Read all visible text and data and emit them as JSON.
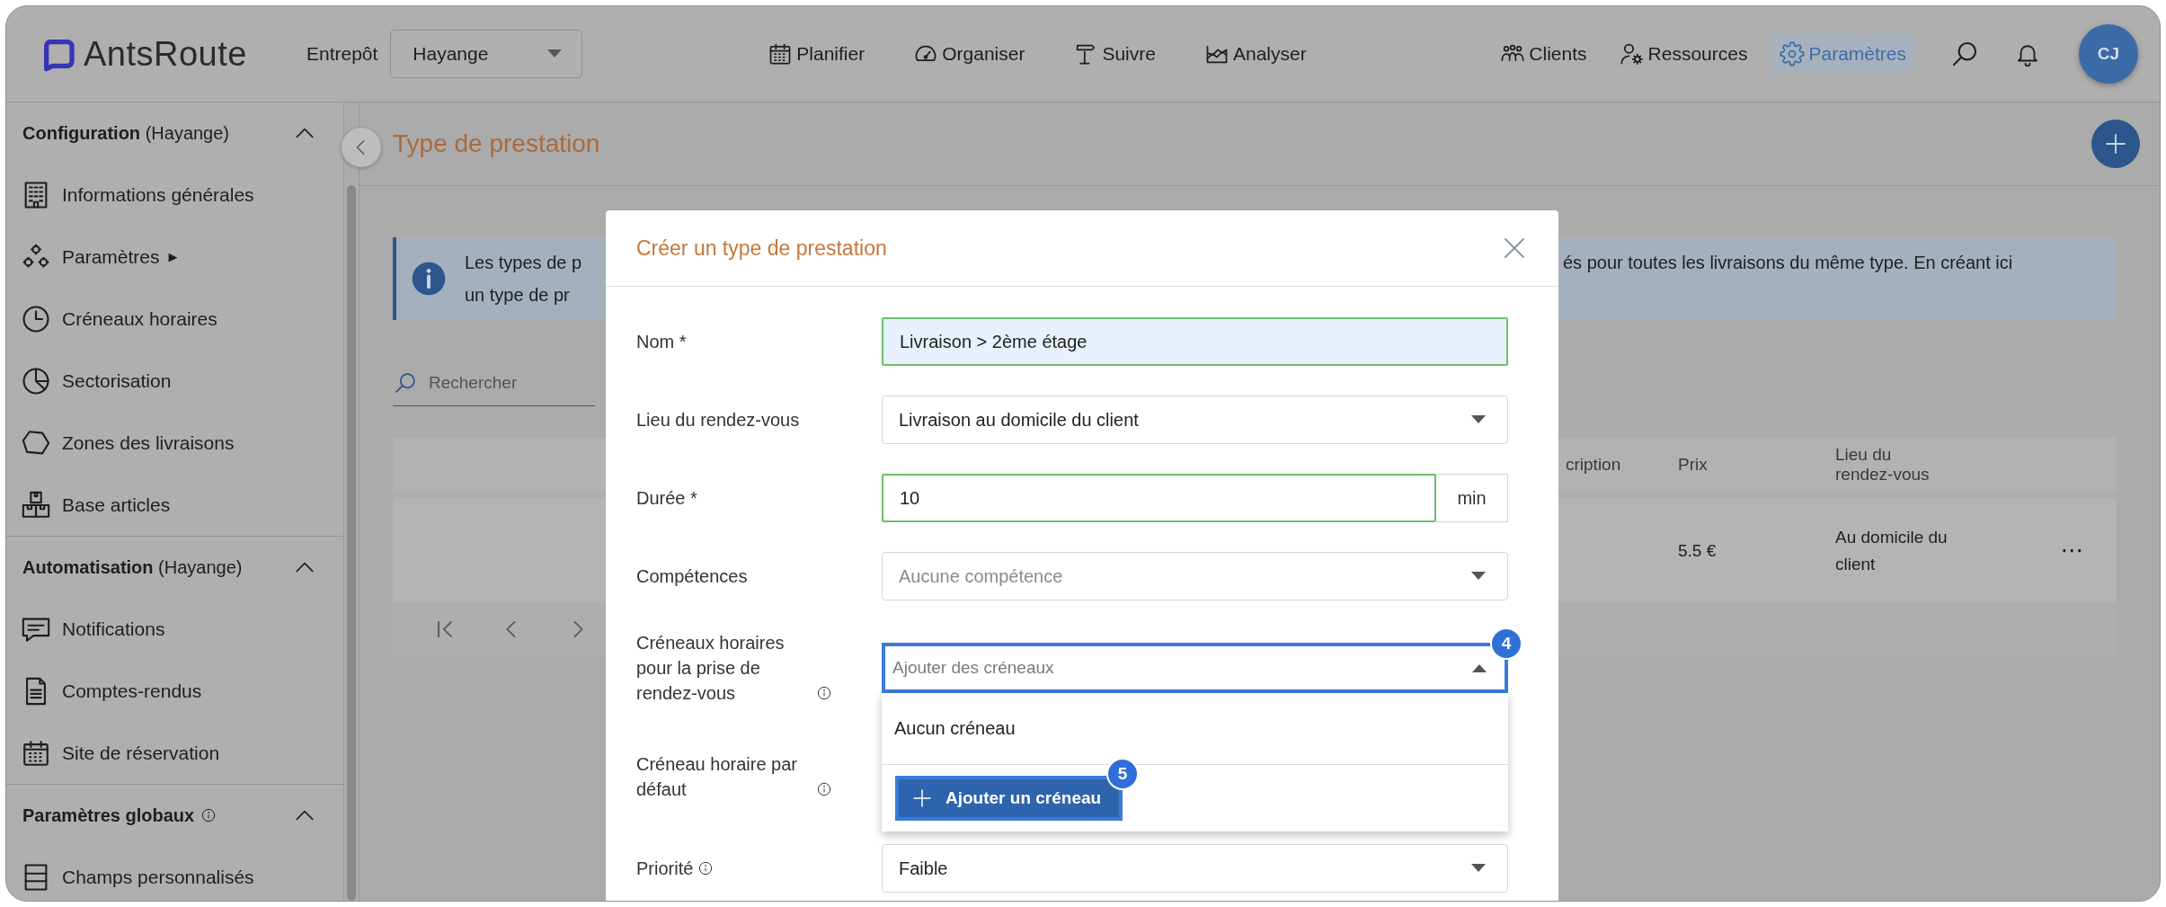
{
  "header": {
    "logo": "**Ants**Route",
    "warehouse_label": "Entrepôt",
    "warehouse_value": "Hayange",
    "nav": [
      {
        "label": "Planifier",
        "selected": false
      },
      {
        "label": "Organiser",
        "selected": false
      },
      {
        "label": "Suivre",
        "selected": false
      },
      {
        "label": "Analyser",
        "selected": false
      }
    ],
    "right_nav": [
      {
        "label": "Clients",
        "selected": false
      },
      {
        "label": "Ressources",
        "selected": false
      },
      {
        "label": "Paramètres",
        "selected": true
      }
    ],
    "avatar": "CJ"
  },
  "sidebar": {
    "sections": [
      {
        "title": "**Configuration** (Hayange)",
        "info": false,
        "expanded": true,
        "items": [
          {
            "label": "Informations générales"
          },
          {
            "label": "Paramètres",
            "marker": "▶"
          },
          {
            "label": "Créneaux horaires"
          },
          {
            "label": "Sectorisation"
          },
          {
            "label": "Zones des livraisons"
          },
          {
            "label": "Base articles"
          }
        ]
      },
      {
        "title": "**Automatisation** (Hayange)",
        "info": false,
        "expanded": true,
        "items": [
          {
            "label": "Notifications"
          },
          {
            "label": "Comptes-rendus"
          },
          {
            "label": "Site de réservation"
          }
        ]
      },
      {
        "title": "**Paramètres globaux**",
        "info": true,
        "expanded": true,
        "items": [
          {
            "label": "Champs personnalisés"
          }
        ]
      }
    ]
  },
  "page": {
    "title": "Type de prestation",
    "info_banner": {
      "line_1_start": "Les types de p",
      "line_1_end": "és pour toutes les livraisons du même type. En créant ici",
      "line_2_start": "un type de pr"
    },
    "search": {
      "placeholder": "Rechercher"
    },
    "table": {
      "columns": [
        "cription",
        "Prix",
        "Lieu du rendez-vous"
      ],
      "rows": [
        {
          "price": "5.5 €",
          "location": "Au domicile du client",
          "menu": "⋯"
        }
      ]
    }
  },
  "dialog": {
    "title": "Créer un type de prestation",
    "fields": [
      {
        "kind": "text",
        "label": "Nom *",
        "info": false,
        "value": "Livraison > 2ème étage",
        "valid": true,
        "autofilled": true
      },
      {
        "kind": "select",
        "label": "Lieu du rendez-vous",
        "info": false,
        "value": "Livraison au domicile du client"
      },
      {
        "kind": "suffix",
        "label": "Durée *",
        "info": false,
        "value": "10",
        "suffix": "min",
        "valid": true,
        "autofilled": false
      },
      {
        "kind": "select",
        "label": "Compétences",
        "info": false,
        "placeholder": "Aucune compétence"
      },
      {
        "kind": "dropdown",
        "label": "Créneaux horaires pour la prise de rendez-vous",
        "info": true,
        "placeholder": "Ajouter des créneaux",
        "expanded": true,
        "step_badge": "4",
        "options": [
          {
            "label": "Aucun créneau"
          }
        ],
        "action": {
          "label": "Ajouter un créneau",
          "step_badge": "5"
        }
      },
      {
        "kind": "covered",
        "label": "Créneau horaire par défaut",
        "info": true
      },
      {
        "kind": "select",
        "label": "Priorité",
        "info": true,
        "value": "Faible"
      }
    ]
  }
}
